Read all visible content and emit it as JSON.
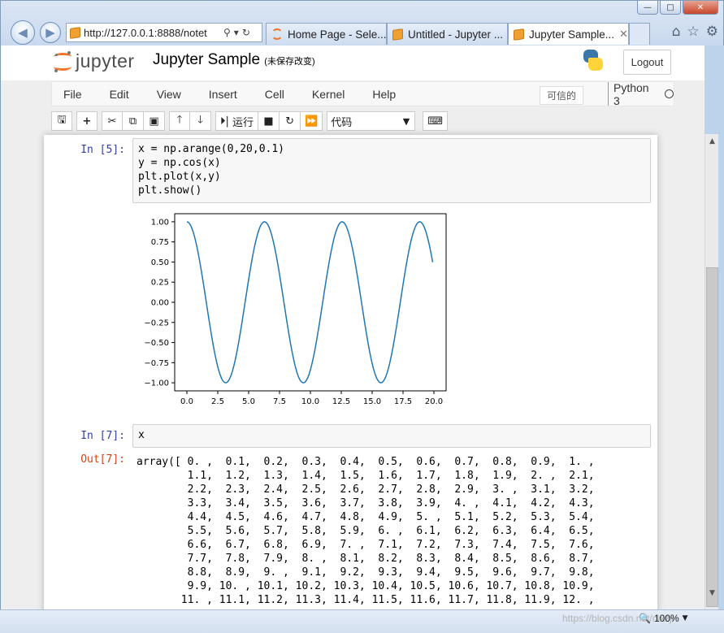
{
  "browser": {
    "address": "http://127.0.0.1:8888/notet",
    "tabs": [
      {
        "label": "Home Page - Sele...",
        "icon": "jupyter-icon",
        "active": false
      },
      {
        "label": "Untitled - Jupyter ...",
        "icon": "page-icon",
        "active": false
      },
      {
        "label": "Jupyter Sample...",
        "icon": "page-icon",
        "active": true
      }
    ],
    "zoom": "100%",
    "watermark": "https://blog.csdn.net/nixzji"
  },
  "header": {
    "logo_text": "jupyter",
    "notebook_name": "Jupyter Sample",
    "autosave": "(未保存改变)",
    "logout": "Logout"
  },
  "menu": {
    "items": [
      "File",
      "Edit",
      "View",
      "Insert",
      "Cell",
      "Kernel",
      "Help"
    ],
    "trusted": "可信的",
    "kernel": "Python 3"
  },
  "toolbar": {
    "run_label": "运行",
    "cell_type": "代码"
  },
  "cells": [
    {
      "prompt": "In [5]:",
      "code": [
        "x = np.arange(0,20,0.1)",
        "y = np.cos(x)",
        "plt.plot(x,y)",
        "plt.show()"
      ]
    },
    {
      "prompt": "In [7]:",
      "code": [
        "x"
      ],
      "out_prompt": "Out[7]:",
      "output": [
        "array([ 0. ,  0.1,  0.2,  0.3,  0.4,  0.5,  0.6,  0.7,  0.8,  0.9,  1. ,",
        "        1.1,  1.2,  1.3,  1.4,  1.5,  1.6,  1.7,  1.8,  1.9,  2. ,  2.1,",
        "        2.2,  2.3,  2.4,  2.5,  2.6,  2.7,  2.8,  2.9,  3. ,  3.1,  3.2,",
        "        3.3,  3.4,  3.5,  3.6,  3.7,  3.8,  3.9,  4. ,  4.1,  4.2,  4.3,",
        "        4.4,  4.5,  4.6,  4.7,  4.8,  4.9,  5. ,  5.1,  5.2,  5.3,  5.4,",
        "        5.5,  5.6,  5.7,  5.8,  5.9,  6. ,  6.1,  6.2,  6.3,  6.4,  6.5,",
        "        6.6,  6.7,  6.8,  6.9,  7. ,  7.1,  7.2,  7.3,  7.4,  7.5,  7.6,",
        "        7.7,  7.8,  7.9,  8. ,  8.1,  8.2,  8.3,  8.4,  8.5,  8.6,  8.7,",
        "        8.8,  8.9,  9. ,  9.1,  9.2,  9.3,  9.4,  9.5,  9.6,  9.7,  9.8,",
        "        9.9, 10. , 10.1, 10.2, 10.3, 10.4, 10.5, 10.6, 10.7, 10.8, 10.9,",
        "       11. , 11.1, 11.2, 11.3, 11.4, 11.5, 11.6, 11.7, 11.8, 11.9, 12. ,"
      ]
    }
  ],
  "chart_data": {
    "type": "line",
    "series": [
      {
        "function": "cos(x)",
        "x_start": 0,
        "x_stop": 20,
        "x_step": 0.1
      }
    ],
    "xlim": [
      0,
      20
    ],
    "ylim": [
      -1,
      1
    ],
    "xticks": [
      "0.0",
      "2.5",
      "5.0",
      "7.5",
      "10.0",
      "12.5",
      "15.0",
      "17.5",
      "20.0"
    ],
    "yticks": [
      "1.00",
      "0.75",
      "0.50",
      "0.25",
      "0.00",
      "−0.25",
      "−0.50",
      "−0.75",
      "−1.00"
    ],
    "line_color": "#1f77b4"
  }
}
